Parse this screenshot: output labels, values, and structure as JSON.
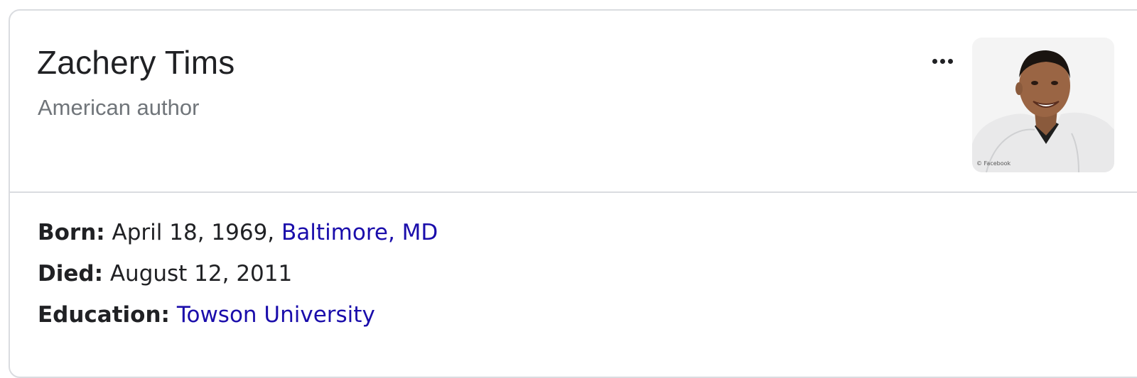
{
  "panel": {
    "title": "Zachery Tims",
    "subtitle": "American author",
    "more_icon": "more-horizontal-icon",
    "photo_credit": "© Facebook"
  },
  "facts": {
    "born": {
      "label": "Born:",
      "value": "April 18, 1969,",
      "link": "Baltimore, MD"
    },
    "died": {
      "label": "Died:",
      "value": "August 12, 2011"
    },
    "education": {
      "label": "Education:",
      "link": "Towson University"
    }
  },
  "colors": {
    "title": "#202124",
    "subtitle": "#70757a",
    "link": "#1a0dab",
    "border": "#dadce0"
  }
}
